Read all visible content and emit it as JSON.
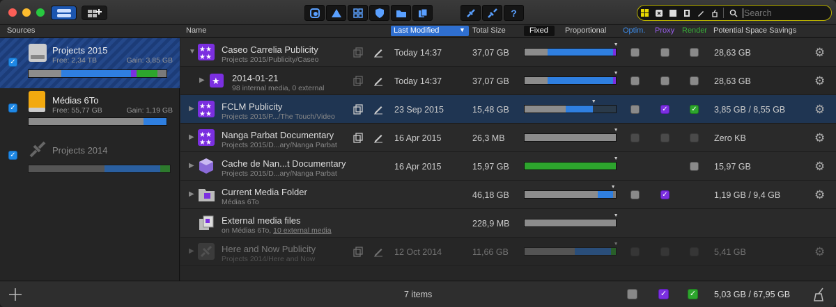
{
  "toolbar": {
    "search_placeholder": "Search"
  },
  "headers": {
    "sources": "Sources",
    "name": "Name",
    "last_modified": "Last Modified",
    "total_size": "Total Size",
    "fixed": "Fixed",
    "proportional": "Proportional",
    "optim": "Optim.",
    "proxy": "Proxy",
    "render": "Render",
    "savings": "Potential Space Savings"
  },
  "sources": [
    {
      "name": "Projects 2015",
      "free": "Free: 2,34 TB",
      "gain": "Gain: 3,85 GB"
    },
    {
      "name": "Médias 6To",
      "free": "Free: 55,77 GB",
      "gain": "Gain: 1,19 GB"
    },
    {
      "name": "Projects 2014"
    }
  ],
  "rows": [
    {
      "title": "Caseo Carrelia Publicity",
      "sub": "Projects 2015/Publicity/Caseo",
      "date": "Today 14:37",
      "size": "37,07 GB",
      "savings": "28,63 GB"
    },
    {
      "title": "2014-01-21",
      "sub": "98 internal media, 0 external",
      "date": "Today 14:37",
      "size": "37,07 GB",
      "savings": "28,63 GB"
    },
    {
      "title": "FCLM Publicity",
      "sub": "Projects 2015/P.../The Touch/Video",
      "date": "23 Sep 2015",
      "size": "15,48 GB",
      "savings": "3,85 GB / 8,55 GB"
    },
    {
      "title": "Nanga Parbat Documentary",
      "sub": "Projects 2015/D...ary/Nanga Parbat",
      "date": "16 Apr 2015",
      "size": "26,3 MB",
      "savings": "Zero KB"
    },
    {
      "title": "Cache de Nan...t Documentary",
      "sub": "Projects 2015/D...ary/Nanga Parbat",
      "date": "16 Apr 2015",
      "size": "15,97 GB",
      "savings": "15,97 GB"
    },
    {
      "title": "Current Media Folder",
      "sub": "Médias 6To",
      "date": "",
      "size": "46,18 GB",
      "savings": "1,19 GB / 9,4 GB"
    },
    {
      "title": "External media files",
      "sub": "on Médias 6To, ",
      "sub_link": "10 external media",
      "date": "",
      "size": "228,9 MB",
      "savings": ""
    },
    {
      "title": "Here and Now Publicity",
      "sub": "Projects 2014/Here and Now",
      "date": "12 Oct 2014",
      "size": "11,66 GB",
      "savings": "5,41 GB"
    }
  ],
  "footer": {
    "items": "7 items",
    "total": "5,03 GB / 67,95 GB"
  },
  "colors": {
    "blue": "#2f7fe0",
    "green": "#2da52d",
    "purple": "#7b2fe0",
    "gray": "#8c8c8c",
    "accent": "#1e88e5"
  }
}
